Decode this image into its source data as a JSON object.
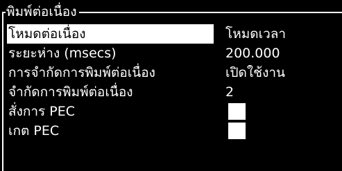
{
  "frame": {
    "title": "พิมพ์ต่อเนื่อง"
  },
  "settings": [
    {
      "label": "โหมดต่อเนื่อง",
      "value": "โหมดเวลา",
      "selected": true
    },
    {
      "label": "ระยะห่าง (msecs)",
      "value": "200.000"
    },
    {
      "label": "การจำกัดการพิมพ์ต่อเนื่อง",
      "value": "เปิดใช้งาน"
    },
    {
      "label": "จำกัดการพิมพ์ต่อเนื่อง",
      "value": "2"
    },
    {
      "label": "สั่งการ PEC",
      "checked": false
    },
    {
      "label": "เกต PEC",
      "checked": false
    }
  ],
  "colors": {
    "background": "#000000",
    "foreground": "#ffffff",
    "selection": "#ffffff",
    "selection_text": "#000000"
  }
}
